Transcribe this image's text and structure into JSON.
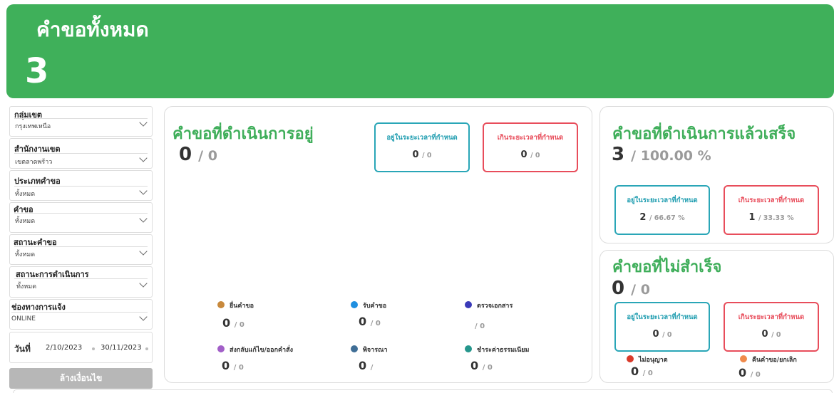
{
  "banner": {
    "title": "คำขอทั้งหมด",
    "count": "3"
  },
  "filters": [
    {
      "label": "กลุ่มเขต",
      "value": "กรุงเทพเหนือ"
    },
    {
      "label": "สำนักงานเขต",
      "value": "เขตลาดพร้าว"
    },
    {
      "label": "ประเภทคำขอ",
      "value": "ทั้งหมด"
    },
    {
      "label": "คำขอ",
      "value": "ทั้งหมด"
    },
    {
      "label": "สถานะคำขอ",
      "value": "ทั้งหมด"
    },
    {
      "label": "สถานะการดำเนินการ",
      "value": "ทั้งหมด"
    },
    {
      "label": "ช่องทางการแจ้ง",
      "value": "ONLINE"
    }
  ],
  "date": {
    "label": "วันที่",
    "from": "2/10/2023",
    "to": "30/11/2023"
  },
  "clear_button": "ล้างเงื่อนไข",
  "in_progress": {
    "title": "คำขอที่ดำเนินการอยู่",
    "value": "0",
    "total": "/ 0",
    "within": {
      "title": "อยู่ในระยะเวลาที่กำหนด",
      "value": "0",
      "sub": "/ 0"
    },
    "over": {
      "title": "เกินระยะเวลาที่กำหนด",
      "value": "0",
      "sub": "/ 0"
    },
    "legend": [
      {
        "label": "ยื่นคำขอ",
        "value": "0",
        "sub": "/ 0",
        "color": "#c8893c"
      },
      {
        "label": "รับคำขอ",
        "value": "0",
        "sub": "/ 0",
        "color": "#1f8fe0"
      },
      {
        "label": "ตรวจเอกสาร",
        "value": "",
        "sub": "/ 0",
        "color": "#3a3ab8"
      },
      {
        "label": "ส่งกลับแก้ไข/ออกคำสั่ง",
        "value": "0",
        "sub": "/ 0",
        "color": "#a25fc8"
      },
      {
        "label": "พิจารณา",
        "value": "0",
        "sub": "/",
        "color": "#3f6e96"
      },
      {
        "label": "ชำระค่าธรรมเนียม",
        "value": "0",
        "sub": "/ 0",
        "color": "#25968c"
      }
    ]
  },
  "completed": {
    "title": "คำขอที่ดำเนินการแล้วเสร็จ",
    "value": "3",
    "total": "/ 100.00 %",
    "within": {
      "title": "อยู่ในระยะเวลาที่กำหนด",
      "value": "2",
      "sub": "/ 66.67 %"
    },
    "over": {
      "title": "เกินระยะเวลาที่กำหนด",
      "value": "1",
      "sub": "/ 33.33 %"
    }
  },
  "failed": {
    "title": "คำขอที่ไม่สำเร็จ",
    "value": "0",
    "total": "/ 0",
    "within": {
      "title": "อยู่ในระยะเวลาที่กำหนด",
      "value": "0",
      "sub": "/ 0"
    },
    "over": {
      "title": "เกินระยะเวลาที่กำหนด",
      "value": "0",
      "sub": "/ 0"
    },
    "legend": [
      {
        "label": "ไม่อนุญาต",
        "value": "0",
        "sub": "/ 0",
        "color": "#d93a2a"
      },
      {
        "label": "คืนคำขอ/ยกเลิก",
        "value": "0",
        "sub": "/ 0",
        "color": "#f08a4b"
      }
    ]
  },
  "colors": {
    "brand_green": "#3fb05a",
    "teal": "#2aa6b7",
    "red": "#e84d5b"
  },
  "icons": {
    "dropdown": "chevron-down-icon"
  }
}
